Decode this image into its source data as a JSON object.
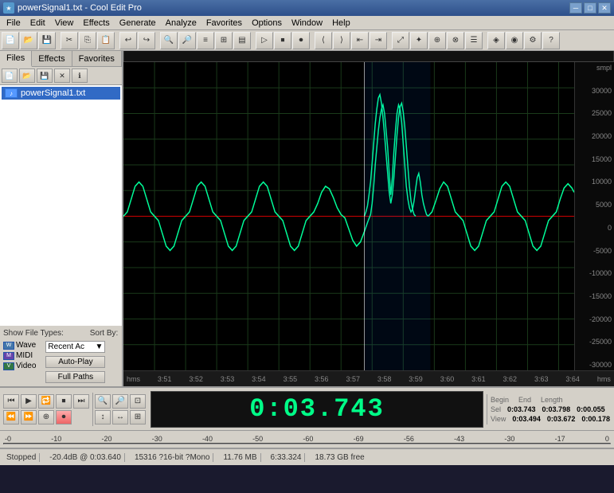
{
  "window": {
    "title": "powerSignal1.txt - Cool Edit Pro",
    "app_icon": "★"
  },
  "titlebar": {
    "minimize": "─",
    "maximize": "□",
    "close": "✕"
  },
  "menu": {
    "items": [
      "File",
      "Edit",
      "View",
      "Effects",
      "Generate",
      "Analyze",
      "Favorites",
      "Options",
      "Window",
      "Help"
    ]
  },
  "left_panel": {
    "tabs": [
      "Files",
      "Effects",
      "Favorites"
    ],
    "active_tab": "Files",
    "file": {
      "name": "powerSignal1.txt",
      "icon": "♪"
    },
    "show_label": "Show File Types:",
    "types": [
      {
        "label": "Wave",
        "icon": "W"
      },
      {
        "label": "MIDI",
        "icon": "M"
      },
      {
        "label": "Video",
        "icon": "V"
      }
    ],
    "sort_label": "Sort By:",
    "sort_value": "Recent Ac",
    "auto_play": "Auto-Play",
    "full_paths": "Full Paths"
  },
  "waveform": {
    "ruler_labels": [
      "hms",
      "3:51",
      "3:52",
      "3:53",
      "3:54",
      "3:55",
      "3:56",
      "3:57",
      "3:58",
      "3:59",
      "3:60",
      "3:61",
      "3:62",
      "3:63",
      "3:64",
      "hms"
    ],
    "axis_labels": [
      "30000",
      "25000",
      "20000",
      "15000",
      "10000",
      "5000",
      "0",
      "-5000",
      "-10000",
      "-15000",
      "-20000",
      "-25000",
      "-30000"
    ],
    "label_smpl": "smpl"
  },
  "time_display": {
    "value": "0:03.743"
  },
  "transport": {
    "begin": {
      "label": "Begin",
      "value": "0:03.743"
    },
    "end": {
      "label": "End",
      "value": "0:03.798"
    },
    "length": {
      "label": "Length",
      "value": "0:00.055"
    },
    "view_begin": {
      "label": "View",
      "value": "0:03.494"
    },
    "view_end": {
      "value": "0:03.672"
    },
    "view_length": {
      "value": "0:00.178"
    },
    "sel_label": "Sel",
    "view_label": "View"
  },
  "position_bar": {
    "labels": [
      "-0",
      "-10",
      "-20",
      "-30",
      "-40",
      "-50",
      "-60",
      "-69",
      "-56",
      "-43",
      "-30",
      "-17",
      "0"
    ]
  },
  "status_bar": {
    "status": "Stopped",
    "db_info": "-20.4dB @ 0:03.640",
    "sample_info": "15316 ?16-bit ?Mono",
    "file_size": "11.76 MB",
    "duration": "6:33.324",
    "free_space": "18.73 GB free"
  }
}
